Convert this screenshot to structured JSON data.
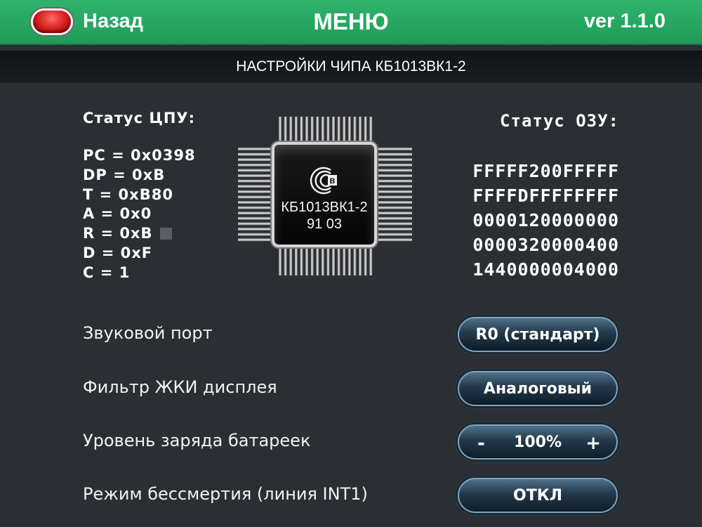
{
  "header": {
    "back_label": "Назад",
    "title": "МЕНЮ",
    "version": "ver 1.1.0"
  },
  "subheader": "НАСТРОЙКИ ЧИПА КБ1013ВК1-2",
  "cpu_status": {
    "title": "Статус ЦПУ:",
    "lines": [
      "PC = 0x0398",
      "DP = 0xB",
      "T = 0xB80",
      "A = 0x0",
      "R = 0xB",
      "D = 0xF",
      "C = 1"
    ]
  },
  "ram_status": {
    "title": "Статус ОЗУ:",
    "lines": [
      "FFFFF200FFFFF",
      "FFFFDFFFFFFFF",
      "0000120000000",
      "0000320000400",
      "1440000004000"
    ]
  },
  "chip": {
    "model": "КБ1013ВК1-2",
    "code": "91 03"
  },
  "settings": [
    {
      "label": "Звуковой порт",
      "value": "R0 (стандарт)"
    },
    {
      "label": "Фильтр ЖКИ дисплея",
      "value": "Аналоговый"
    },
    {
      "label": "Уровень заряда батареек",
      "value": "100%",
      "minus": "-",
      "plus": "+"
    },
    {
      "label": "Режим бессмертия (линия INT1)",
      "value": "ОТКЛ"
    }
  ],
  "colors": {
    "header_green": "#2fb36c",
    "background": "#2b2f34",
    "back_button_red": "#d41a1a",
    "pill_blue": "#23384a"
  }
}
